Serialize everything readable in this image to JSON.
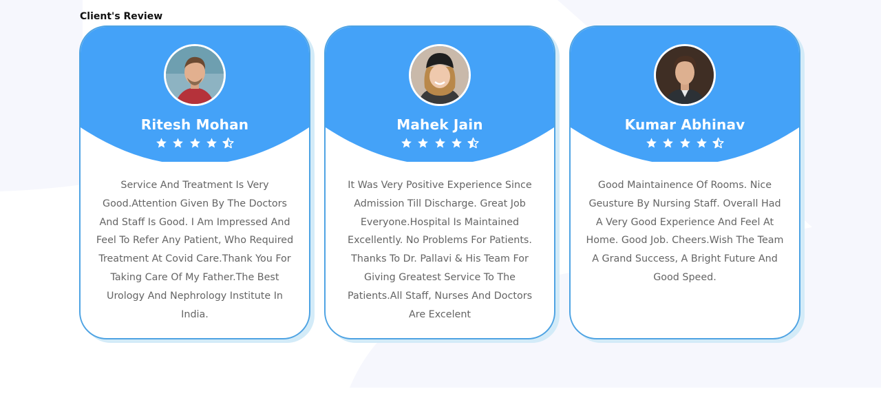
{
  "section": {
    "title": "Client's Review"
  },
  "colors": {
    "card_header": "#44a2f8",
    "card_border": "#4ea3e3",
    "card_shadow": "#d3ebf8",
    "background_shape": "#f6f7fd",
    "review_text": "#646464"
  },
  "reviews": [
    {
      "name": "Ritesh Mohan",
      "rating": 4.5,
      "rating_icons": [
        "star-icon",
        "star-icon",
        "star-icon",
        "star-icon",
        "star-half-icon"
      ],
      "text": "Service And Treatment Is Very Good.Attention Given By The Doctors And Staff Is Good. I Am Impressed And Feel To Refer Any Patient, Who Required Treatment At Covid Care.Thank You For Taking Care Of My Father.The Best Urology And Nephrology Institute In India."
    },
    {
      "name": "Mahek Jain",
      "rating": 4.5,
      "rating_icons": [
        "star-icon",
        "star-icon",
        "star-icon",
        "star-icon",
        "star-half-icon"
      ],
      "text": "It Was Very Positive Experience Since Admission Till Discharge. Great Job Everyone.Hospital Is Maintained Excellently. No Problems For Patients. Thanks To Dr. Pallavi & His Team For Giving Greatest Service To The Patients.All Staff, Nurses And Doctors Are Excelent"
    },
    {
      "name": "Kumar Abhinav",
      "rating": 4.5,
      "rating_icons": [
        "star-icon",
        "star-icon",
        "star-icon",
        "star-icon",
        "star-half-icon"
      ],
      "text": "Good Maintainence Of Rooms. Nice Geusture By Nursing Staff. Overall Had A Very Good Experience And Feel At Home. Good Job. Cheers.Wish The Team A Grand Success, A Bright Future And Good Speed."
    }
  ]
}
